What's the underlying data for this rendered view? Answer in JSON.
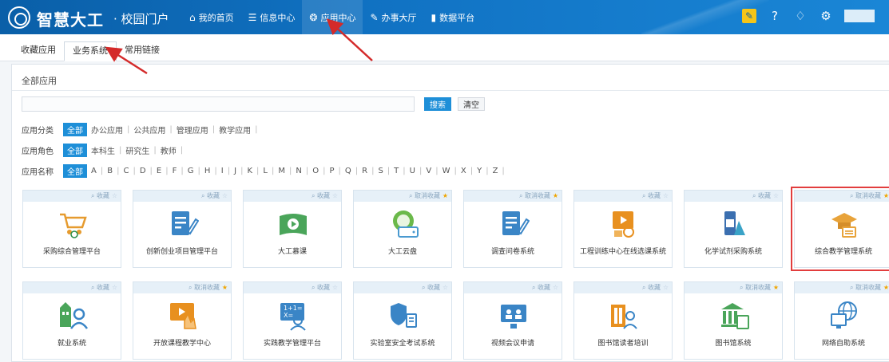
{
  "header": {
    "title": "智慧大工",
    "subtitle": "· 校园门户",
    "nav": [
      {
        "icon": "home-icon",
        "glyph": "⌂",
        "label": "我的首页"
      },
      {
        "icon": "list-icon",
        "glyph": "☰",
        "label": "信息中心"
      },
      {
        "icon": "apps-icon",
        "glyph": "❂",
        "label": "应用中心"
      },
      {
        "icon": "edit-square-icon",
        "glyph": "✎",
        "label": "办事大厅"
      },
      {
        "icon": "bar-chart-icon",
        "glyph": "▮",
        "label": "数据平台"
      }
    ]
  },
  "tabs": [
    {
      "label": "收藏应用"
    },
    {
      "label": "业务系统"
    },
    {
      "label": "常用链接"
    }
  ],
  "panel": {
    "title": "全部应用",
    "search_placeholder": "",
    "search_button": "搜索",
    "clear_button": "清空"
  },
  "filters": {
    "category": {
      "label": "应用分类",
      "options": [
        "全部",
        "办公应用",
        "公共应用",
        "管理应用",
        "教学应用"
      ]
    },
    "role": {
      "label": "应用角色",
      "options": [
        "全部",
        "本科生",
        "研究生",
        "教师"
      ]
    },
    "name": {
      "label": "应用名称",
      "options": [
        "全部",
        "A",
        "B",
        "C",
        "D",
        "E",
        "F",
        "G",
        "H",
        "I",
        "J",
        "K",
        "L",
        "M",
        "N",
        "O",
        "P",
        "Q",
        "R",
        "S",
        "T",
        "U",
        "V",
        "W",
        "X",
        "Y",
        "Z"
      ]
    }
  },
  "apps": [
    {
      "name": "采购综合管理平台",
      "fav": "收藏",
      "starred": false,
      "icon": "shopping-cart-icon"
    },
    {
      "name": "创新创业项目管理平台",
      "fav": "收藏",
      "starred": false,
      "icon": "document-edit-icon"
    },
    {
      "name": "大工慕课",
      "fav": "收藏",
      "starred": false,
      "icon": "video-book-icon"
    },
    {
      "name": "大工云盘",
      "fav": "取消收藏",
      "starred": true,
      "icon": "cloud-drive-icon"
    },
    {
      "name": "调查问卷系统",
      "fav": "取消收藏",
      "starred": true,
      "icon": "questionnaire-icon"
    },
    {
      "name": "工程训练中心在线选课系统",
      "fav": "收藏",
      "starred": false,
      "icon": "course-select-icon"
    },
    {
      "name": "化学试剂采购系统",
      "fav": "收藏",
      "starred": false,
      "icon": "chemical-flask-icon"
    },
    {
      "name": "综合教学管理系统",
      "fav": "取消收藏",
      "starred": true,
      "icon": "graduation-cap-icon"
    },
    {
      "name": "就业系统",
      "fav": "收藏",
      "starred": false,
      "icon": "employment-icon"
    },
    {
      "name": "开放课程教学中心",
      "fav": "取消收藏",
      "starred": true,
      "icon": "open-course-icon"
    },
    {
      "name": "实践教学管理平台",
      "fav": "收藏",
      "starred": false,
      "icon": "practice-teaching-icon"
    },
    {
      "name": "实验室安全考试系统",
      "fav": "收藏",
      "starred": false,
      "icon": "lab-safety-icon"
    },
    {
      "name": "视频会议申请",
      "fav": "收藏",
      "starred": false,
      "icon": "video-conference-icon"
    },
    {
      "name": "图书馆读者培训",
      "fav": "收藏",
      "starred": false,
      "icon": "library-reader-icon"
    },
    {
      "name": "图书馆系统",
      "fav": "取消收藏",
      "starred": true,
      "icon": "library-building-icon"
    },
    {
      "name": "网络自助系统",
      "fav": "取消收藏",
      "starred": true,
      "icon": "network-globe-icon"
    }
  ],
  "colors": {
    "accent": "#1e8fd8",
    "header": "#0a5fa8",
    "highlight": "#e23d3d",
    "star": "#f0a500"
  }
}
